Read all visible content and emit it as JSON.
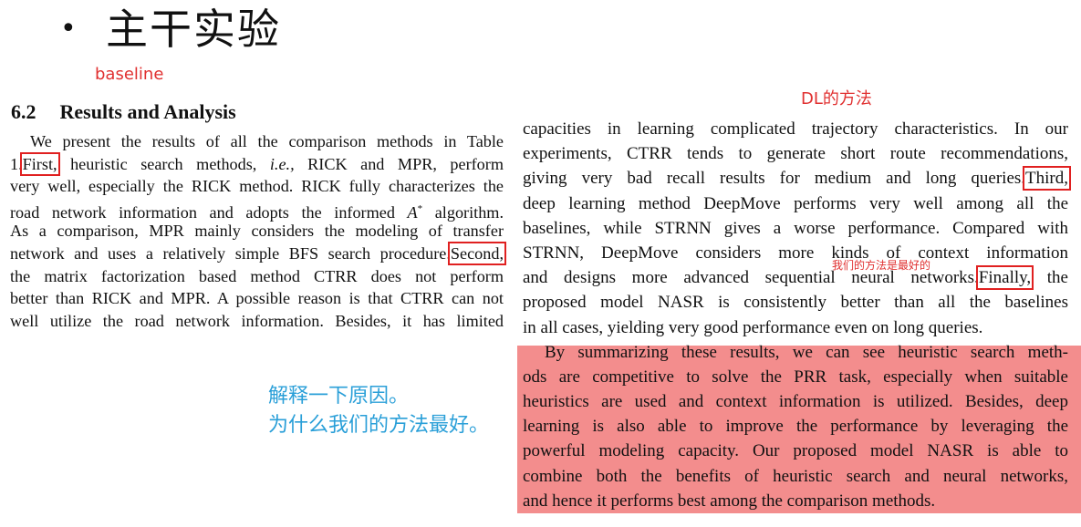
{
  "slide": {
    "bullet": "•",
    "title": "主干实验"
  },
  "annotations": {
    "baseline": "baseline",
    "dl_methods": "DL的方法",
    "ours_best": "我们的方法是最好的",
    "explain_1": "解释一下原因。",
    "explain_2": "为什么我们的方法最好。"
  },
  "section": {
    "number": "6.2",
    "title": "Results and Analysis"
  },
  "left_column": {
    "l1": "We present the results of all the comparison methods in Table",
    "l2_a": "1.",
    "l2_box": "First,",
    "l2_b": " heuristic search methods, ",
    "l2_ie": "i.e.,",
    "l2_c": " RICK and MPR, perform",
    "l3": "very well, especially the RICK method. RICK fully characterizes the",
    "l4_a": "road network information and adopts the informed ",
    "l4_astar": "A",
    "l4_sup": "*",
    "l4_b": " algorithm.",
    "l5": "As a comparison, MPR mainly considers the modeling of transfer",
    "l6_a": "network and uses a relatively simple BFS search procedure.",
    "l6_box": "Second,",
    "l7": "the matrix factorization based method CTRR does not perform",
    "l8": "better than RICK and MPR. A possible reason is that CTRR can not",
    "l9": "well utilize the road network information. Besides, it has limited"
  },
  "right_column": {
    "r1": "capacities in learning complicated trajectory characteristics. In our",
    "r2": "experiments, CTRR tends to generate short route recommendations,",
    "r3_a": "giving very bad recall results for medium and long queries.",
    "r3_box": "Third,",
    "r4": "deep learning method DeepMove performs very well among all the",
    "r5": "baselines, while STRNN gives a worse performance. Compared with",
    "r6": "STRNN, DeepMove considers more kinds of context information",
    "r7_a": "and designs more advanced sequential neural networks.",
    "r7_box": "Finally,",
    "r7_b": " the",
    "r8": "proposed model NASR is consistently better than all the baselines",
    "r9": "in all cases, yielding very good performance even on long queries.",
    "p2_1": "By summarizing these results, we can see heuristic search meth-",
    "p2_2": "ods are competitive to solve the PRR task, especially when suitable",
    "p2_3": "heuristics are used and context information is utilized. Besides, deep",
    "p2_4": "learning is also able to improve the performance by leveraging the",
    "p2_5": "powerful modeling capacity. Our proposed model NASR is able to",
    "p2_6": "combine both the benefits of heuristic search and neural networks,",
    "p2_7": "and hence it performs best among the comparison methods."
  },
  "colors": {
    "annotation_red": "#e03030",
    "annotation_blue": "#2a9fd8",
    "box_red": "#e02020",
    "highlight_pink": "#f38d8d"
  }
}
